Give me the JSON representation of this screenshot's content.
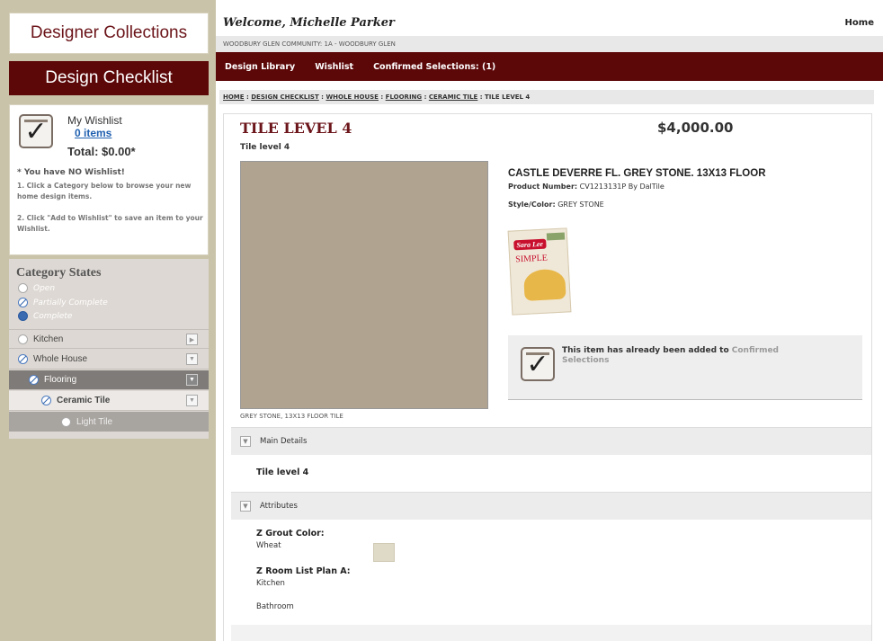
{
  "sidebar": {
    "designer_collections": "Designer Collections",
    "design_checklist": "Design Checklist",
    "wishlist": {
      "title": "My Wishlist",
      "items_link": "0 items",
      "total": "Total: $0.00*",
      "no_wishlist": "* You have NO Wishlist!",
      "step1": "1. Click a Category below to browse your new home design items.",
      "step2": "2. Click \"Add to Wishlist\" to save an item to your Wishlist."
    },
    "category_states": {
      "title": "Category States",
      "legend": [
        "Open",
        "Partially Complete",
        "Complete"
      ]
    },
    "categories": [
      {
        "label": "Kitchen"
      },
      {
        "label": "Whole House"
      },
      {
        "label": "Flooring"
      },
      {
        "label": "Ceramic Tile"
      },
      {
        "label": "Light Tile"
      }
    ]
  },
  "header": {
    "welcome": "Welcome, Michelle Parker",
    "home": "Home",
    "community": "WOODBURY GLEN COMMUNITY: 1A - WOODBURY GLEN"
  },
  "nav": {
    "items": [
      "Design Library",
      "Wishlist",
      "Confirmed Selections: (1)"
    ]
  },
  "breadcrumb": {
    "links": [
      "HOME",
      "DESIGN CHECKLIST",
      "WHOLE HOUSE",
      "FLOORING",
      "CERAMIC TILE"
    ],
    "current": "TILE LEVEL 4",
    "separator": " : "
  },
  "product": {
    "title": "TILE LEVEL 4",
    "price": "$4,000.00",
    "subtitle": "Tile level 4",
    "image_caption": "GREY STONE, 13X13 FLOOR TILE",
    "name": "CASTLE DEVERRE FL. GREY STONE. 13X13 FLOOR",
    "number_label": "Product Number:",
    "number_value": "CV1213131P By DalTile",
    "style_label": "Style/Color:",
    "style_value": "GREY STONE",
    "promo_brand": "Sara Lee",
    "promo_word": "SIMPLE",
    "added_text": "This item has already been added to",
    "added_link": "Confirmed Selections"
  },
  "details": {
    "main_header": "Main Details",
    "main_text": "Tile level 4",
    "attr_header": "Attributes",
    "grout_label": "Z Grout Color:",
    "grout_value": "Wheat",
    "grout_swatch": "#dfdac7",
    "room_label": "Z Room List Plan A:",
    "room_values": [
      "Kitchen",
      "Bathroom"
    ]
  },
  "colors": {
    "maroon": "#5c0708",
    "sidebar_tan": "#c9c3a9",
    "link_blue": "#2060b0"
  }
}
